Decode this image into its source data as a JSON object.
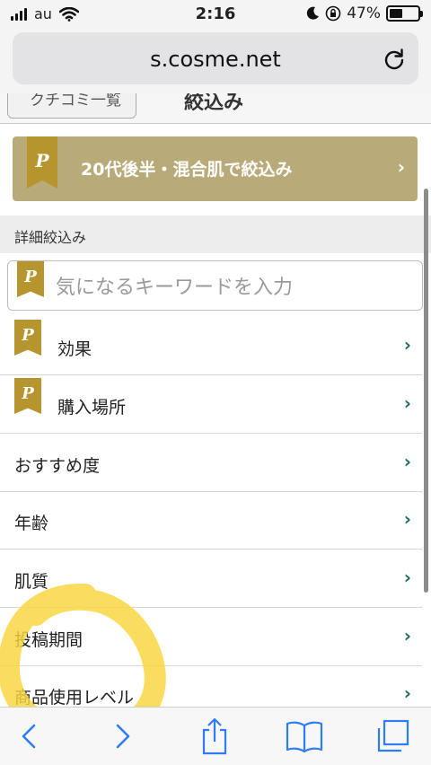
{
  "status_bar": {
    "carrier": "au",
    "time": "2:16",
    "battery_percent": "47%",
    "battery_level": 0.47
  },
  "url_bar": {
    "url": "s.cosme.net"
  },
  "page_header": {
    "back_label": "クチコミ一覧",
    "title": "絞込み"
  },
  "banner": {
    "text": "20代後半・混合肌で絞込み",
    "chevron": "›",
    "badge": "P"
  },
  "section": {
    "title": "詳細絞込み"
  },
  "search": {
    "placeholder": "気になるキーワードを入力",
    "badge": "P"
  },
  "rows": [
    {
      "label": "効果",
      "badge": "P",
      "chevron": "›"
    },
    {
      "label": "購入場所",
      "badge": "P",
      "chevron": "›"
    },
    {
      "label": "おすすめ度",
      "chevron": "›"
    },
    {
      "label": "年齢",
      "chevron": "›"
    },
    {
      "label": "肌質",
      "chevron": "›"
    },
    {
      "label": "投稿期間",
      "chevron": "›"
    },
    {
      "label": "商品使用レベル",
      "chevron": "›"
    }
  ],
  "colors": {
    "banner": "#b9ab79",
    "ribbon": "#b7952e",
    "chevron": "#1f6c63",
    "ios_blue": "#2f7cf6",
    "highlight": "#f9d53a"
  },
  "toolbar": {
    "icons": [
      "back-icon",
      "forward-icon",
      "share-icon",
      "bookmarks-icon",
      "tabs-icon"
    ]
  }
}
